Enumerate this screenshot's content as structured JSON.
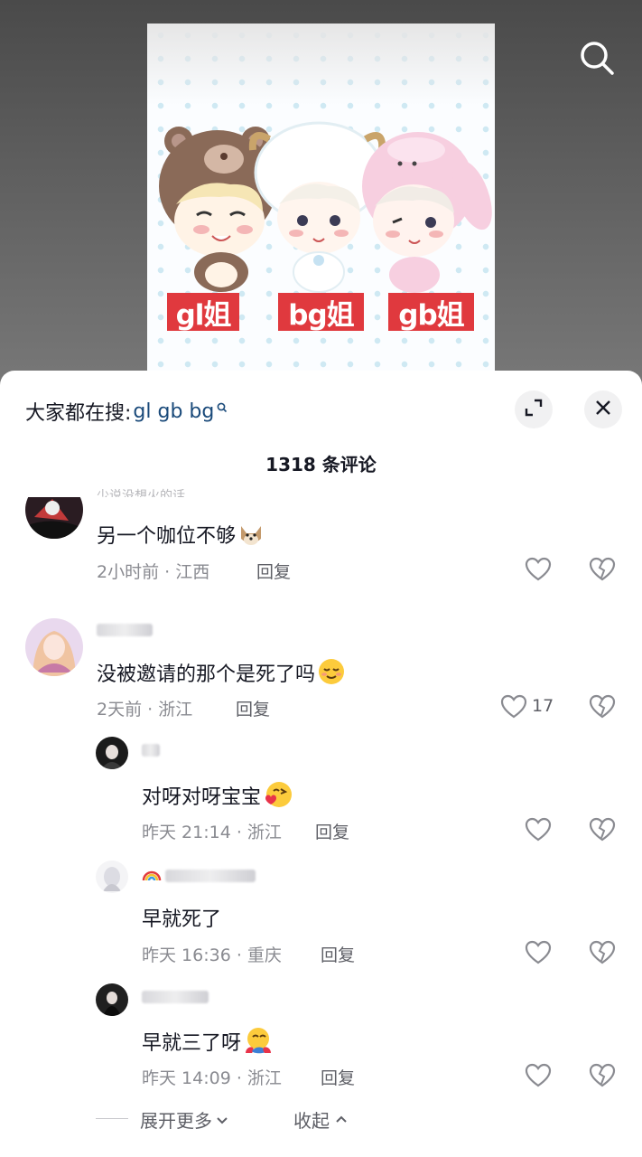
{
  "video": {
    "cover_tags": [
      "gl姐",
      "bg姐",
      "gb姐"
    ]
  },
  "comments_panel": {
    "searched_label": "大家都在搜:",
    "searched_terms": "gl gb bg",
    "comment_count": "1318 条评论",
    "comments": [
      {
        "username": "少说没想火的话",
        "text": "另一个咖位不够",
        "emoji": "shiba-dog-emoji",
        "time": "2小时前 · 江西",
        "reply": "回复",
        "likes": ""
      },
      {
        "username": "",
        "text": "没被邀请的那个是死了吗",
        "emoji": "relieved-face-emoji",
        "time": "2天前 · 浙江",
        "reply": "回复",
        "likes": "17"
      }
    ],
    "replies": [
      {
        "username": "",
        "text": "对呀对呀宝宝",
        "emoji": "kissing-heart-emoji",
        "time": "昨天 21:14 · 浙江",
        "reply": "回复"
      },
      {
        "username": "",
        "text": "早就死了",
        "emoji": "",
        "time": "昨天 16:36 · 重庆",
        "reply": "回复"
      },
      {
        "username": "",
        "text": "早就三了呀",
        "emoji": "hugging-face-emoji",
        "time": "昨天 14:09 · 浙江",
        "reply": "回复"
      }
    ],
    "expand_label": "展开更多",
    "collapse_label": "收起"
  },
  "colors": {
    "tag_red": "#e0393e",
    "search_terms_blue": "#1a4a7a",
    "meta_grey": "#8a8b91"
  }
}
